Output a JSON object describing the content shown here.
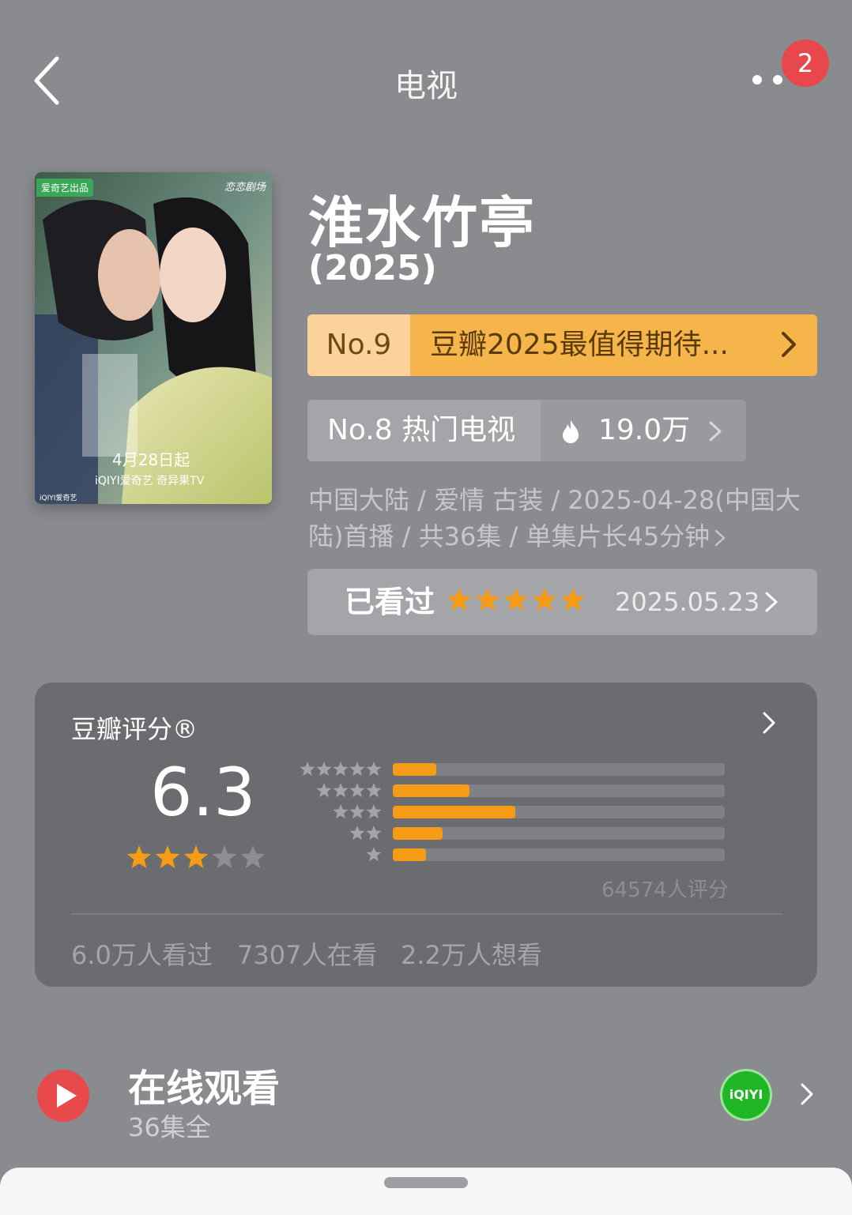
{
  "nav": {
    "title": "电视",
    "badge_count": "2"
  },
  "poster": {
    "tag": "爱奇艺出品",
    "brand": "恋恋剧场",
    "date": "4月28日起",
    "platform": "iQIYI爱奇艺 奇异果TV",
    "footer": "iQIYI爱奇艺"
  },
  "show": {
    "title": "淮水竹亭",
    "year": "(2025)"
  },
  "ranking_primary": {
    "number": "No.9",
    "label": "豆瓣2025最值得期待..."
  },
  "ranking_secondary": {
    "label": "No.8 热门电视",
    "hot_count": "19.0万"
  },
  "meta_text": "中国大陆 / 爱情 古装 / 2025-04-28(中国大陆)首播 / 共36集 / 单集片长45分钟",
  "watched": {
    "label": "已看过",
    "user_stars": 5,
    "date": "2025.05.23"
  },
  "rating": {
    "title": "豆瓣评分®",
    "score": "6.3",
    "score_stars": 3,
    "votes": "64574人评分",
    "distribution": [
      {
        "stars": 5,
        "fraction": 0.13
      },
      {
        "stars": 4,
        "fraction": 0.23
      },
      {
        "stars": 3,
        "fraction": 0.37
      },
      {
        "stars": 2,
        "fraction": 0.15
      },
      {
        "stars": 1,
        "fraction": 0.1
      }
    ],
    "stats": {
      "watched": "6.0万人看过",
      "watching": "7307人在看",
      "wish": "2.2万人想看"
    }
  },
  "online": {
    "title": "在线观看",
    "subtitle": "36集全",
    "provider_icon": "iQIYI"
  },
  "colors": {
    "background": "#8a8b8f",
    "accent_orange": "#f59b15",
    "badge_red": "#e8474b",
    "card": "#6b6c70",
    "rank_bar": "#f6b54a"
  }
}
